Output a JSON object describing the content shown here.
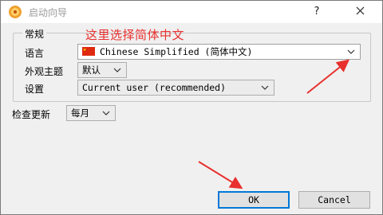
{
  "window": {
    "title": "启动向导"
  },
  "titlebar": {
    "help": "?"
  },
  "group": {
    "label": "常规"
  },
  "annotation": "这里选择简体中文",
  "fields": {
    "language": {
      "label": "语言",
      "value": "Chinese Simplified (简体中文)"
    },
    "theme": {
      "label": "外观主题",
      "value": "默认"
    },
    "settings": {
      "label": "设置",
      "value": "Current user (recommended)"
    },
    "update": {
      "label": "检查更新",
      "value": "每月"
    }
  },
  "buttons": {
    "ok": "OK",
    "cancel": "Cancel"
  },
  "colors": {
    "annotation": "#e8302e",
    "accent": "#0078d7",
    "arrow": "#e8302e"
  }
}
